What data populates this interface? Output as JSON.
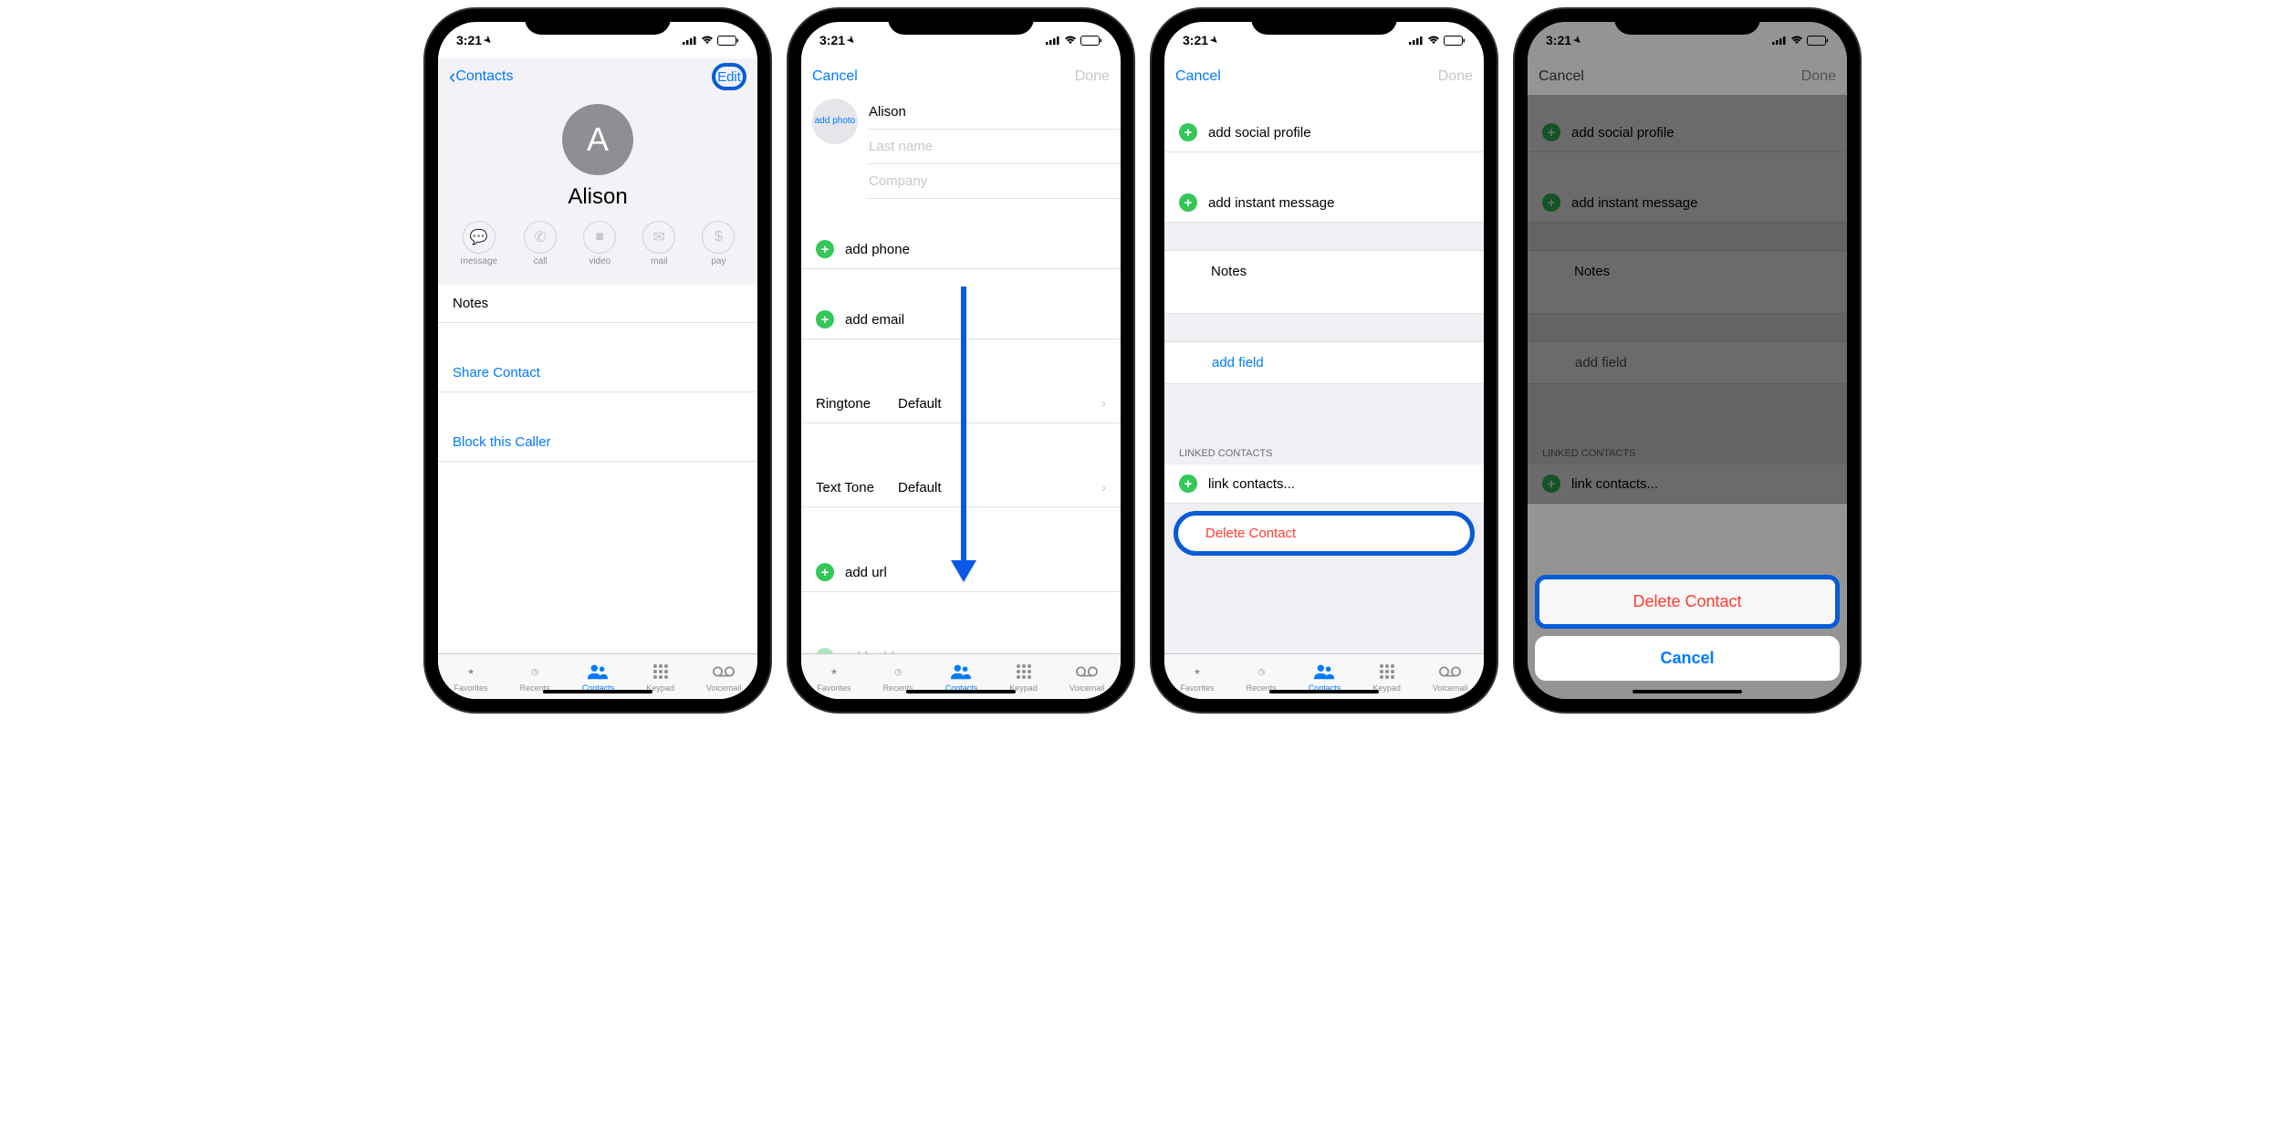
{
  "status": {
    "time": "3:21",
    "location_icon": "◀"
  },
  "s1": {
    "back": "Contacts",
    "edit": "Edit",
    "avatar_initial": "A",
    "name": "Alison",
    "actions": [
      {
        "label": "message"
      },
      {
        "label": "call"
      },
      {
        "label": "video"
      },
      {
        "label": "mail"
      },
      {
        "label": "pay"
      }
    ],
    "notes": "Notes",
    "share": "Share Contact",
    "block": "Block this Caller"
  },
  "s2": {
    "cancel": "Cancel",
    "done": "Done",
    "add_photo": "add photo",
    "first_name": "Alison",
    "last_name_ph": "Last name",
    "company_ph": "Company",
    "add_phone": "add phone",
    "add_email": "add email",
    "ringtone": {
      "label": "Ringtone",
      "value": "Default"
    },
    "texttone": {
      "label": "Text Tone",
      "value": "Default"
    },
    "add_url": "add url",
    "add_address": "add address"
  },
  "s3": {
    "cancel": "Cancel",
    "done": "Done",
    "add_social": "add social profile",
    "add_im": "add instant message",
    "notes": "Notes",
    "add_field": "add field",
    "linked_header": "LINKED CONTACTS",
    "link_contacts": "link contacts...",
    "delete": "Delete Contact"
  },
  "s4": {
    "cancel": "Cancel",
    "done": "Done",
    "add_social": "add social profile",
    "add_im": "add instant message",
    "notes": "Notes",
    "add_field": "add field",
    "linked_header": "LINKED CONTACTS",
    "link_contacts": "link contacts...",
    "sheet_delete": "Delete Contact",
    "sheet_cancel": "Cancel"
  },
  "tabs": [
    {
      "label": "Favorites"
    },
    {
      "label": "Recents"
    },
    {
      "label": "Contacts"
    },
    {
      "label": "Keypad"
    },
    {
      "label": "Voicemail"
    }
  ]
}
